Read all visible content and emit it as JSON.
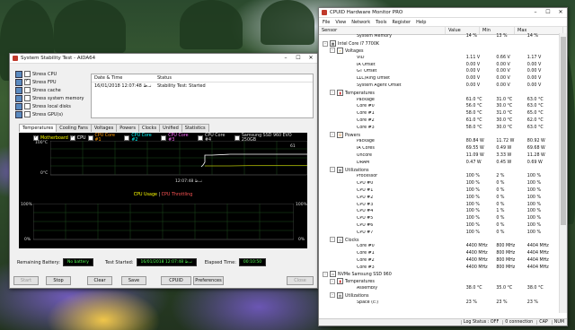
{
  "aida": {
    "title": "System Stability Test - AIDA64",
    "stress_items": [
      {
        "label": "Stress CPU",
        "checked": false
      },
      {
        "label": "Stress FPU",
        "checked": true
      },
      {
        "label": "Stress cache",
        "checked": false
      },
      {
        "label": "Stress system memory",
        "checked": false
      },
      {
        "label": "Stress local disks",
        "checked": false
      },
      {
        "label": "Stress GPU(s)",
        "checked": false
      }
    ],
    "status_table": {
      "headers": [
        "Date & Time",
        "Status"
      ],
      "rows": [
        [
          "16/01/2018 12:07:48 نـ.ظ",
          "Stability Test: Started"
        ]
      ]
    },
    "tabs": [
      "Temperatures",
      "Cooling Fans",
      "Voltages",
      "Powers",
      "Clocks",
      "Unified",
      "Statistics"
    ],
    "active_tab": "Temperatures",
    "temp_graph": {
      "legend": [
        {
          "label": "Motherboard",
          "color": "#ffff00",
          "checked": true
        },
        {
          "label": "CPU",
          "color": "#ffffff",
          "checked": true
        },
        {
          "label": "CPU Core #1",
          "color": "#ff9900",
          "checked": false
        },
        {
          "label": "CPU Core #2",
          "color": "#00ffff",
          "checked": false
        },
        {
          "label": "CPU Core #3",
          "color": "#ff66ff",
          "checked": false
        },
        {
          "label": "CPU Core #4",
          "color": "#dddddd",
          "checked": false
        },
        {
          "label": "Samsung SSD 960 EVO 250GB",
          "color": "#dddddd",
          "checked": false
        }
      ],
      "ytop": "100°C",
      "ybottom": "0°C",
      "current": "61",
      "time_label": "12:07:48 نـ.ظ"
    },
    "usage_graph": {
      "title_usage": "CPU Usage",
      "title_sep": "|",
      "title_throttle": "CPU Throttling",
      "left_top": "100%",
      "left_bottom": "0%",
      "right_top": "100%",
      "right_bottom": "0%"
    },
    "bottom_info": {
      "battery_label": "Remaining Battery:",
      "battery_value": "No battery",
      "started_label": "Test Started:",
      "started_value": "16/01/2018 12:07:48 نـ.ظ",
      "elapsed_label": "Elapsed Time:",
      "elapsed_value": "00:10:50"
    },
    "buttons": {
      "start": "Start",
      "stop": "Stop",
      "clear": "Clear",
      "save": "Save",
      "cpuid": "CPUID",
      "preferences": "Preferences",
      "close": "Close"
    }
  },
  "hwm": {
    "title": "CPUID Hardware Monitor PRO",
    "menu": [
      "File",
      "View",
      "Network",
      "Tools",
      "Register",
      "Help"
    ],
    "columns": [
      "Sensor",
      "Value",
      "Min",
      "Max"
    ],
    "rows": [
      {
        "level": 3,
        "name": "System Memory",
        "value": "14 %",
        "min": "13 %",
        "max": "14 %"
      },
      {
        "level": 0,
        "name": "Intel Core i7 7700K",
        "icon": "chip",
        "pm": "-"
      },
      {
        "level": 1,
        "name": "Voltages",
        "icon": "volt",
        "pm": "-"
      },
      {
        "level": 3,
        "name": "VID",
        "value": "1.11 V",
        "min": "0.66 V",
        "max": "1.17 V"
      },
      {
        "level": 3,
        "name": "IA Offset",
        "value": "0.00 V",
        "min": "0.00 V",
        "max": "0.00 V"
      },
      {
        "level": 3,
        "name": "GT Offset",
        "value": "0.00 V",
        "min": "0.00 V",
        "max": "0.00 V"
      },
      {
        "level": 3,
        "name": "LLC/Ring Offset",
        "value": "0.00 V",
        "min": "0.00 V",
        "max": "0.00 V"
      },
      {
        "level": 3,
        "name": "System Agent Offset",
        "value": "0.00 V",
        "min": "0.00 V",
        "max": "0.00 V"
      },
      {
        "level": 1,
        "name": "Temperatures",
        "icon": "temp",
        "pm": "-"
      },
      {
        "level": 3,
        "name": "Package",
        "value": "61.0 °C",
        "min": "31.0 °C",
        "max": "63.0 °C"
      },
      {
        "level": 3,
        "name": "Core #0",
        "value": "56.0 °C",
        "min": "30.0 °C",
        "max": "63.0 °C"
      },
      {
        "level": 3,
        "name": "Core #1",
        "value": "58.0 °C",
        "min": "31.0 °C",
        "max": "65.0 °C"
      },
      {
        "level": 3,
        "name": "Core #2",
        "value": "61.0 °C",
        "min": "30.0 °C",
        "max": "62.0 °C"
      },
      {
        "level": 3,
        "name": "Core #3",
        "value": "58.0 °C",
        "min": "30.0 °C",
        "max": "63.0 °C"
      },
      {
        "level": 1,
        "name": "Powers",
        "icon": "power",
        "pm": "-"
      },
      {
        "level": 3,
        "name": "Package",
        "value": "80.84 W",
        "min": "11.72 W",
        "max": "80.92 W"
      },
      {
        "level": 3,
        "name": "IA Cores",
        "value": "69.55 W",
        "min": "0.49 W",
        "max": "69.68 W"
      },
      {
        "level": 3,
        "name": "Uncore",
        "value": "11.09 W",
        "min": "3.33 W",
        "max": "11.28 W"
      },
      {
        "level": 3,
        "name": "DRAM",
        "value": "0.47 W",
        "min": "0.45 W",
        "max": "0.69 W"
      },
      {
        "level": 1,
        "name": "Utilizations",
        "icon": "util",
        "pm": "-"
      },
      {
        "level": 3,
        "name": "Processor",
        "value": "100 %",
        "min": "2 %",
        "max": "100 %"
      },
      {
        "level": 3,
        "name": "CPU #0",
        "value": "100 %",
        "min": "0 %",
        "max": "100 %"
      },
      {
        "level": 3,
        "name": "CPU #1",
        "value": "100 %",
        "min": "0 %",
        "max": "100 %"
      },
      {
        "level": 3,
        "name": "CPU #2",
        "value": "100 %",
        "min": "0 %",
        "max": "100 %"
      },
      {
        "level": 3,
        "name": "CPU #3",
        "value": "100 %",
        "min": "0 %",
        "max": "100 %"
      },
      {
        "level": 3,
        "name": "CPU #4",
        "value": "100 %",
        "min": "1 %",
        "max": "100 %"
      },
      {
        "level": 3,
        "name": "CPU #5",
        "value": "100 %",
        "min": "0 %",
        "max": "100 %"
      },
      {
        "level": 3,
        "name": "CPU #6",
        "value": "100 %",
        "min": "0 %",
        "max": "100 %"
      },
      {
        "level": 3,
        "name": "CPU #7",
        "value": "100 %",
        "min": "0 %",
        "max": "100 %"
      },
      {
        "level": 1,
        "name": "Clocks",
        "icon": "clock",
        "pm": "-"
      },
      {
        "level": 3,
        "name": "Core #0",
        "value": "4400 MHz",
        "min": "800 MHz",
        "max": "4404 MHz"
      },
      {
        "level": 3,
        "name": "Core #1",
        "value": "4400 MHz",
        "min": "800 MHz",
        "max": "4404 MHz"
      },
      {
        "level": 3,
        "name": "Core #2",
        "value": "4400 MHz",
        "min": "800 MHz",
        "max": "4404 MHz"
      },
      {
        "level": 3,
        "name": "Core #3",
        "value": "4400 MHz",
        "min": "800 MHz",
        "max": "4404 MHz"
      },
      {
        "level": 0,
        "name": "NVMe Samsung SSD 960",
        "icon": "disk",
        "pm": "-"
      },
      {
        "level": 1,
        "name": "Temperatures",
        "icon": "temp",
        "pm": "-"
      },
      {
        "level": 3,
        "name": "Assembly",
        "value": "38.0 °C",
        "min": "35.0 °C",
        "max": "38.0 °C"
      },
      {
        "level": 1,
        "name": "Utilizations",
        "icon": "util",
        "pm": "-"
      },
      {
        "level": 3,
        "name": "Space (c:)",
        "value": "23 %",
        "min": "23 %",
        "max": "23 %"
      }
    ],
    "status": {
      "log": "Log Status : OFF",
      "conn": "0 connection",
      "cap": "CAP",
      "num": "NUM"
    }
  }
}
